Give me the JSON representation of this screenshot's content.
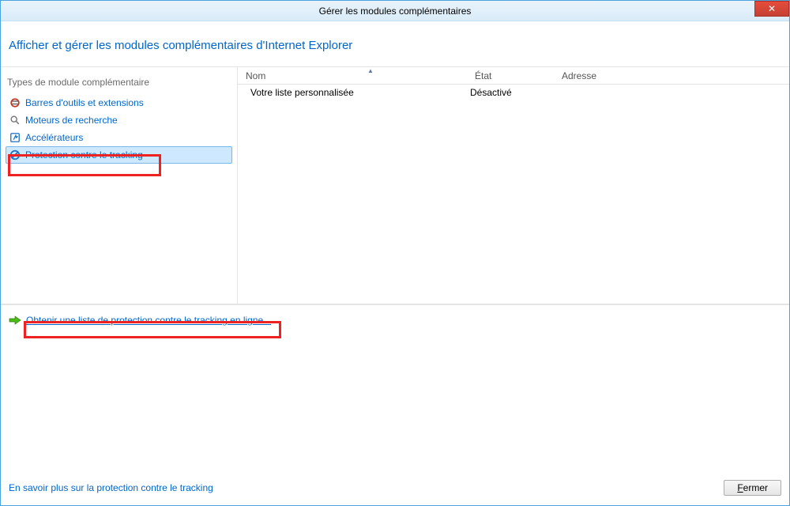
{
  "window": {
    "title": "Gérer les modules complémentaires",
    "close_glyph": "✕"
  },
  "header": {
    "page_title": "Afficher et gérer les modules complémentaires d'Internet Explorer"
  },
  "sidebar": {
    "heading": "Types de module complémentaire",
    "items": [
      {
        "label": "Barres d'outils et extensions",
        "icon": "toolbars"
      },
      {
        "label": "Moteurs de recherche",
        "icon": "search"
      },
      {
        "label": "Accélérateurs",
        "icon": "accel"
      },
      {
        "label": "Protection contre le tracking",
        "icon": "block"
      }
    ]
  },
  "columns": {
    "nom": "Nom",
    "etat": "État",
    "adresse": "Adresse"
  },
  "rows": [
    {
      "nom": "Votre liste personnalisée",
      "etat": "Désactivé",
      "adresse": ""
    }
  ],
  "lower": {
    "link_online": "Obtenir une liste de protection contre le tracking en ligne..."
  },
  "footer": {
    "learn_more": "En savoir plus sur la protection contre le tracking",
    "close_prefix": "F",
    "close_rest": "ermer"
  }
}
